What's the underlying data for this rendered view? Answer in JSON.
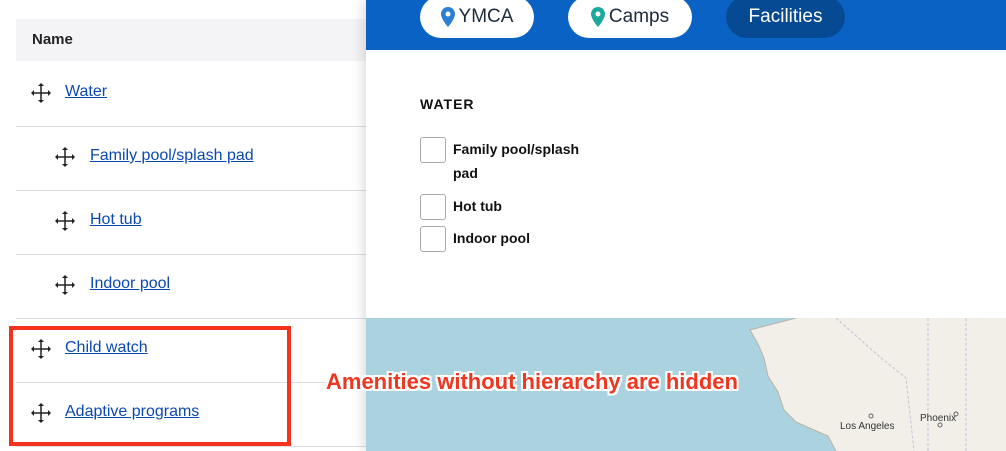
{
  "table": {
    "column_name": "Name",
    "rows": [
      {
        "label": "Water"
      },
      {
        "label": "Family pool/splash pad"
      },
      {
        "label": "Hot tub"
      },
      {
        "label": "Indoor pool"
      },
      {
        "label": "Child watch"
      },
      {
        "label": "Adaptive programs"
      }
    ]
  },
  "preview": {
    "tabs": [
      {
        "label": "YMCA",
        "icon": "map-pin-icon"
      },
      {
        "label": "Camps",
        "icon": "map-pin-icon"
      },
      {
        "label": "Facilities"
      }
    ],
    "filter": {
      "title": "WATER",
      "options": [
        {
          "label": "Family pool/splash pad",
          "checked": false
        },
        {
          "label": "Hot tub",
          "checked": false
        },
        {
          "label": "Indoor pool",
          "checked": false
        }
      ]
    },
    "map": {
      "labels": {
        "city1": "Los Angeles",
        "city2": "Phoenix"
      }
    }
  },
  "annotation": {
    "text": "Amenities without hierarchy are hidden",
    "color": "#ee3620"
  },
  "colors": {
    "header_blue": "#0a63c4",
    "active_tab": "#064a93",
    "link": "#0b49b0",
    "ymca_pin": "#2a7fd4",
    "camps_pin": "#1aa99a"
  }
}
